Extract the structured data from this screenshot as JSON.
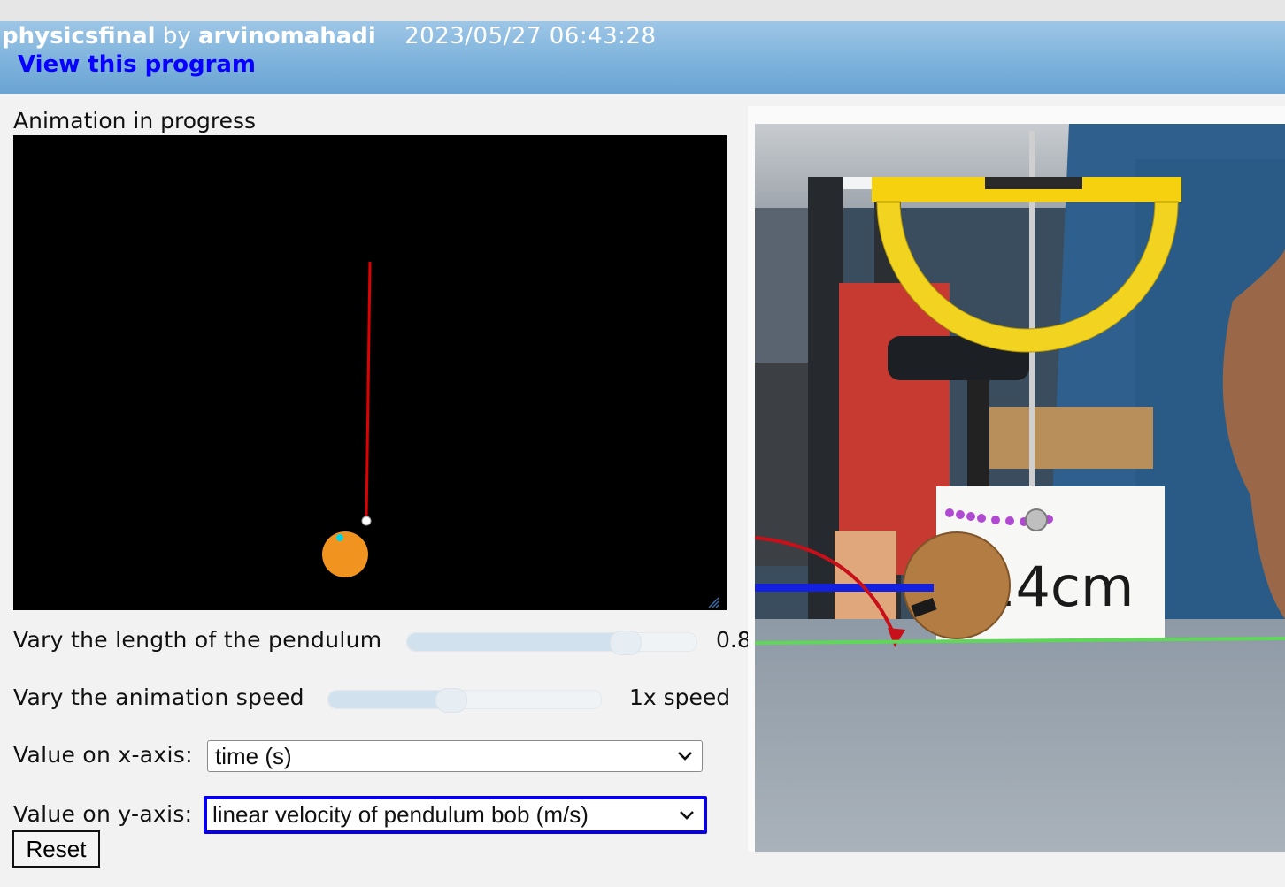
{
  "header": {
    "program_name": "physicsfinal",
    "by": "by",
    "author": "arvinomahadi",
    "timestamp": "2023/05/27 06:43:28",
    "link_text": "View this program"
  },
  "status_text": "Animation in progress",
  "controls": {
    "length_label": "Vary the length of the pendulum",
    "length_value_text": "0.8",
    "length_slider_fraction": 0.78,
    "speed_label": "Vary the animation speed",
    "speed_value_text": "1x speed",
    "speed_slider_fraction": 0.44,
    "x_axis_label": "Value on x-axis:",
    "x_axis_selected": "time (s)",
    "y_axis_label": "Value on y-axis:",
    "y_axis_selected": "linear velocity of pendulum bob (m/s)",
    "reset_label": "Reset"
  },
  "photo": {
    "board_text": "14cm"
  },
  "colors": {
    "string": "#e00000",
    "bob": "#f0931f",
    "pivot": "#ffffff",
    "marker": "#00d7e6",
    "protractor": "#f2d320",
    "link": "#0a00ff",
    "focus_border": "#0a00e8"
  }
}
